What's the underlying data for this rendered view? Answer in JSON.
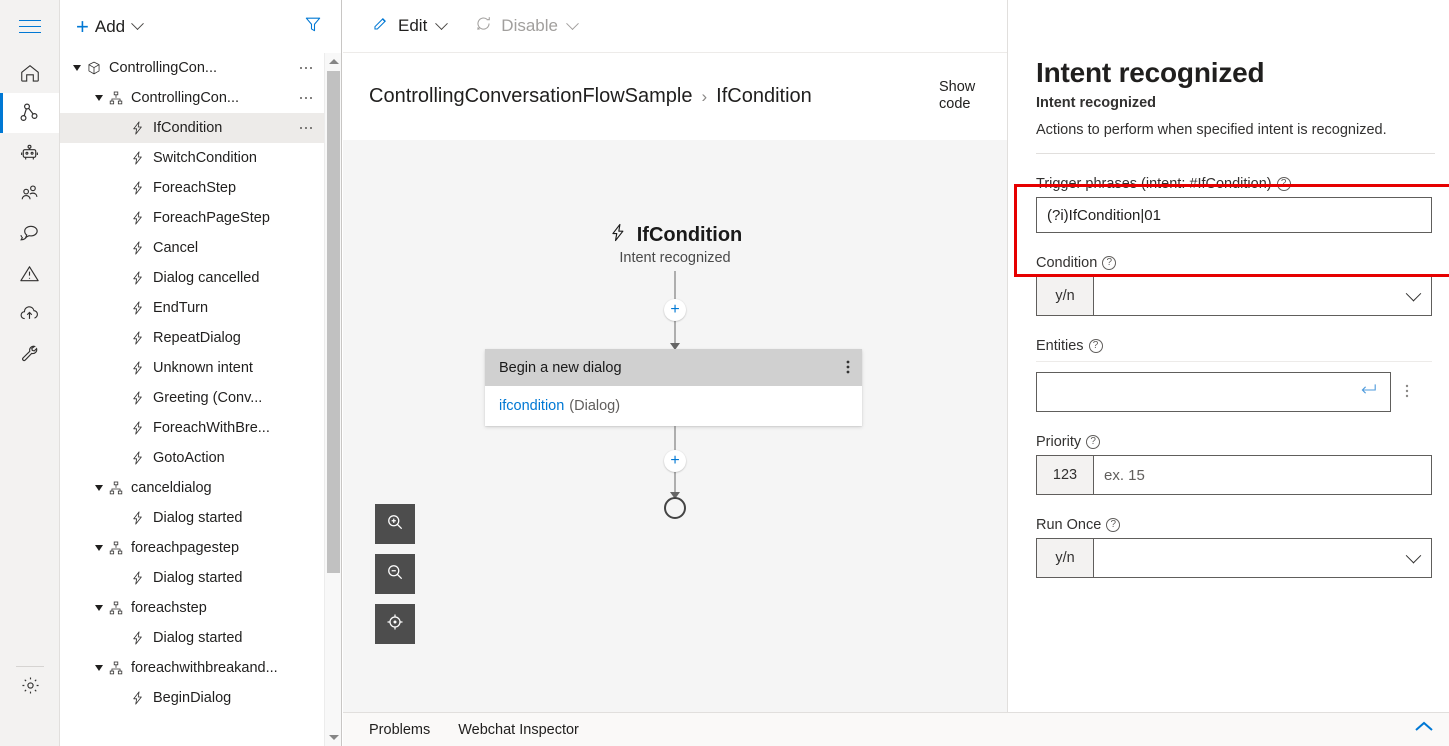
{
  "rail": {
    "hamburger_label": "menu-toggle",
    "items": [
      {
        "name": "home",
        "icon": "home-icon",
        "active": false
      },
      {
        "name": "design",
        "icon": "dialog-flow-icon",
        "active": true
      },
      {
        "name": "bot-says",
        "icon": "robot-icon",
        "active": false
      },
      {
        "name": "user-says",
        "icon": "users-icon",
        "active": false
      },
      {
        "name": "evaluate-performance",
        "icon": "chat-bubbles-icon",
        "active": false
      },
      {
        "name": "notifications",
        "icon": "warning-triangle-icon",
        "active": false
      },
      {
        "name": "publish",
        "icon": "cloud-upload-icon",
        "active": false
      },
      {
        "name": "skills",
        "icon": "wrench-icon",
        "active": false
      }
    ],
    "settings": {
      "name": "settings",
      "icon": "gear-icon"
    }
  },
  "tree_toolbar": {
    "add_label": "Add",
    "add_icon": "plus-icon",
    "add_chevron_icon": "chevron-down-icon",
    "filter_icon": "filter-icon"
  },
  "tree": {
    "items": [
      {
        "label": "ControllingCon...",
        "icon": "bot-package-icon",
        "indent": 0,
        "caret": true,
        "ellipsis": true,
        "selected": false
      },
      {
        "label": "ControllingCon...",
        "icon": "dialog-icon",
        "indent": 1,
        "caret": true,
        "ellipsis": true,
        "selected": false
      },
      {
        "label": "IfCondition",
        "icon": "trigger-icon",
        "indent": 2,
        "caret": false,
        "ellipsis": true,
        "selected": true
      },
      {
        "label": "SwitchCondition",
        "icon": "trigger-icon",
        "indent": 2,
        "caret": false,
        "ellipsis": false,
        "selected": false
      },
      {
        "label": "ForeachStep",
        "icon": "trigger-icon",
        "indent": 2,
        "caret": false,
        "ellipsis": false,
        "selected": false
      },
      {
        "label": "ForeachPageStep",
        "icon": "trigger-icon",
        "indent": 2,
        "caret": false,
        "ellipsis": false,
        "selected": false
      },
      {
        "label": "Cancel",
        "icon": "trigger-icon",
        "indent": 2,
        "caret": false,
        "ellipsis": false,
        "selected": false
      },
      {
        "label": "Dialog cancelled",
        "icon": "trigger-icon",
        "indent": 2,
        "caret": false,
        "ellipsis": false,
        "selected": false
      },
      {
        "label": "EndTurn",
        "icon": "trigger-icon",
        "indent": 2,
        "caret": false,
        "ellipsis": false,
        "selected": false
      },
      {
        "label": "RepeatDialog",
        "icon": "trigger-icon",
        "indent": 2,
        "caret": false,
        "ellipsis": false,
        "selected": false
      },
      {
        "label": "Unknown intent",
        "icon": "trigger-icon",
        "indent": 2,
        "caret": false,
        "ellipsis": false,
        "selected": false
      },
      {
        "label": "Greeting (Conv...",
        "icon": "trigger-icon",
        "indent": 2,
        "caret": false,
        "ellipsis": false,
        "selected": false
      },
      {
        "label": "ForeachWithBre...",
        "icon": "trigger-icon",
        "indent": 2,
        "caret": false,
        "ellipsis": false,
        "selected": false
      },
      {
        "label": "GotoAction",
        "icon": "trigger-icon",
        "indent": 2,
        "caret": false,
        "ellipsis": false,
        "selected": false
      },
      {
        "label": "canceldialog",
        "icon": "dialog-icon",
        "indent": 1,
        "caret": true,
        "ellipsis": false,
        "selected": false
      },
      {
        "label": "Dialog started",
        "icon": "trigger-icon",
        "indent": 2,
        "caret": false,
        "ellipsis": false,
        "selected": false
      },
      {
        "label": "foreachpagestep",
        "icon": "dialog-icon",
        "indent": 1,
        "caret": true,
        "ellipsis": false,
        "selected": false
      },
      {
        "label": "Dialog started",
        "icon": "trigger-icon",
        "indent": 2,
        "caret": false,
        "ellipsis": false,
        "selected": false
      },
      {
        "label": "foreachstep",
        "icon": "dialog-icon",
        "indent": 1,
        "caret": true,
        "ellipsis": false,
        "selected": false
      },
      {
        "label": "Dialog started",
        "icon": "trigger-icon",
        "indent": 2,
        "caret": false,
        "ellipsis": false,
        "selected": false
      },
      {
        "label": "foreachwithbreakand...",
        "icon": "dialog-icon",
        "indent": 1,
        "caret": true,
        "ellipsis": false,
        "selected": false
      },
      {
        "label": "BeginDialog",
        "icon": "trigger-icon",
        "indent": 2,
        "caret": false,
        "ellipsis": false,
        "selected": false
      }
    ],
    "scrollbar": {
      "up_icon": "scroll-up-arrow-icon",
      "down_icon": "scroll-down-arrow-icon"
    }
  },
  "center_toolbar": {
    "edit_label": "Edit",
    "edit_icon": "pencil-icon",
    "disable_label": "Disable",
    "disable_icon": "disable-circle-icon",
    "chevron_icon": "chevron-down-icon"
  },
  "breadcrumb": {
    "root": "ControllingConversationFlowSample",
    "separator": "›",
    "current": "IfCondition",
    "show_code_label": "Show code"
  },
  "canvas": {
    "node_title": "IfCondition",
    "node_title_icon": "trigger-icon",
    "node_subtitle": "Intent recognized",
    "add_node_icon": "plus-icon",
    "card": {
      "header": "Begin a new dialog",
      "menu_icon": "more-vertical-icon",
      "body_link": "ifcondition",
      "body_suffix": "(Dialog)"
    },
    "end_node_icon": "end-circle-icon",
    "zoom_in_icon": "zoom-in-icon",
    "zoom_out_icon": "zoom-out-icon",
    "focus_icon": "focus-target-icon"
  },
  "properties": {
    "title": "Intent recognized",
    "subtitle": "Intent recognized",
    "description": "Actions to perform when specified intent is recognized.",
    "help_icon": "help-circle-icon",
    "fields": {
      "trigger_phrases": {
        "label": "Trigger phrases (intent: #IfCondition)",
        "value": "(?i)IfCondition|01",
        "highlighted": true
      },
      "condition": {
        "label": "Condition",
        "prefix": "y/n",
        "value": "",
        "chevron_icon": "chevron-down-icon"
      },
      "entities": {
        "label": "Entities",
        "value": "",
        "submit_icon": "enter-return-icon",
        "menu_icon": "more-vertical-icon"
      },
      "priority": {
        "label": "Priority",
        "prefix": "123",
        "value": "",
        "placeholder": "ex. 15"
      },
      "run_once": {
        "label": "Run Once",
        "prefix": "y/n",
        "value": "",
        "chevron_icon": "chevron-down-icon"
      }
    }
  },
  "statusbar": {
    "tabs": [
      "Problems",
      "Webchat Inspector"
    ],
    "collapse_icon": "chevron-up-icon"
  },
  "colors": {
    "accent": "#0078d4",
    "highlight": "#e60000",
    "canvas_bg": "#f5f5f5",
    "card_header": "#d0d0d0",
    "selected_row": "#edebe9"
  }
}
